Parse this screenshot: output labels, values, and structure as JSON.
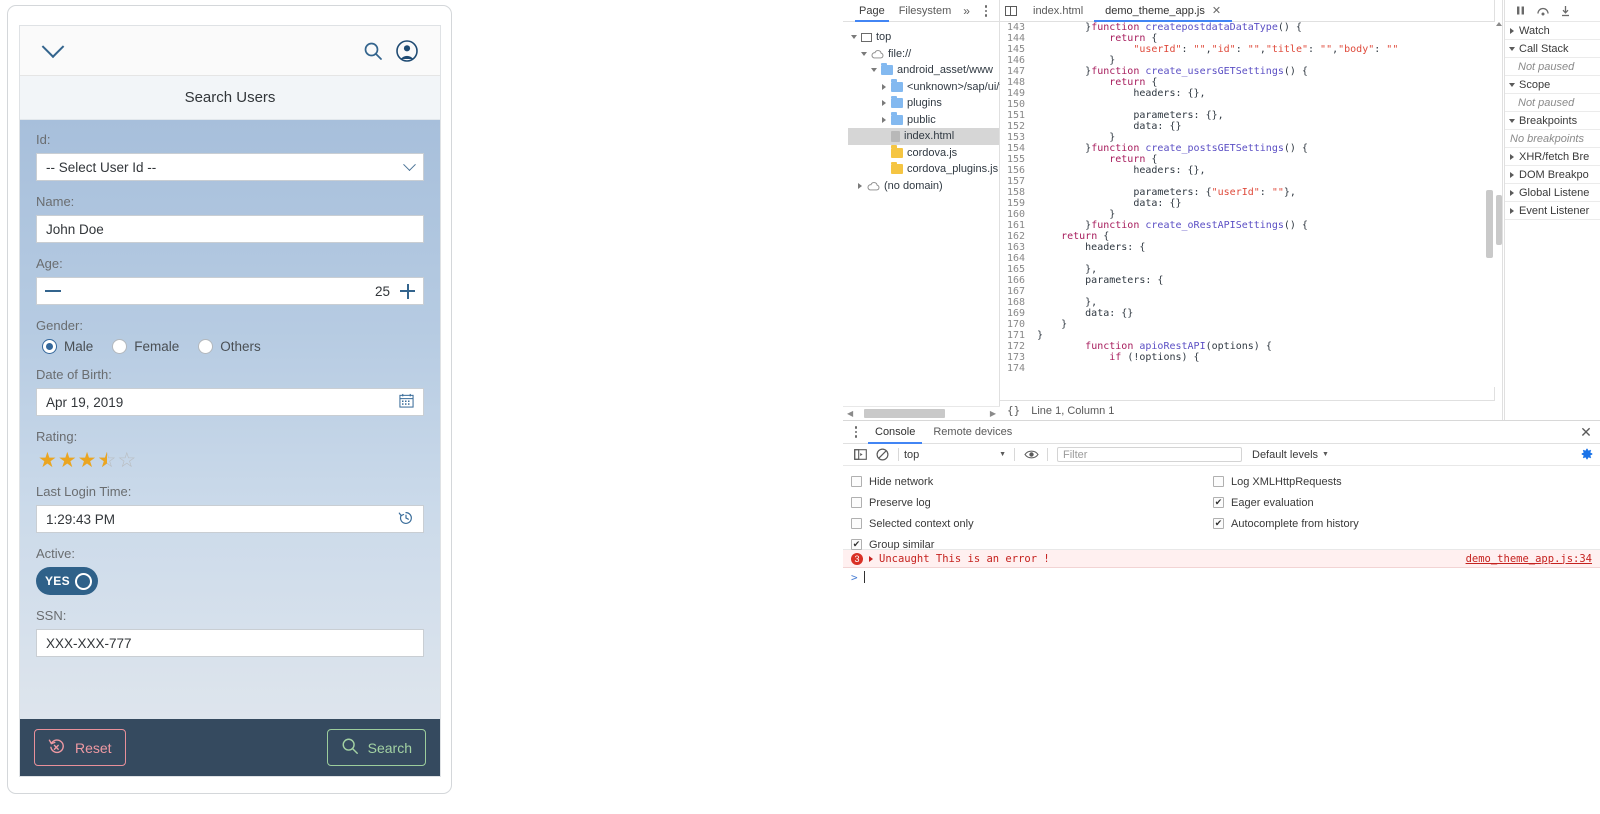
{
  "app": {
    "shellbar": {
      "menu_icon": "chevron-down-icon",
      "search_icon": "search-icon",
      "avatar_icon": "user-avatar-icon"
    },
    "page_title": "Search Users",
    "fields": {
      "id": {
        "label": "Id:",
        "value": "-- Select User Id --"
      },
      "name": {
        "label": "Name:",
        "value": "John Doe"
      },
      "age": {
        "label": "Age:",
        "value": "25",
        "minus_icon": "minus-icon",
        "plus_icon": "plus-icon"
      },
      "gender": {
        "label": "Gender:",
        "options": [
          {
            "label": "Male",
            "selected": true
          },
          {
            "label": "Female",
            "selected": false
          },
          {
            "label": "Others",
            "selected": false
          }
        ]
      },
      "dob": {
        "label": "Date of Birth:",
        "value": "Apr 19, 2019",
        "icon": "calendar-icon"
      },
      "rating": {
        "label": "Rating:",
        "value": 3.5,
        "max": 5,
        "color": "#eaa521"
      },
      "last_login": {
        "label": "Last Login Time:",
        "value": "1:29:43 PM",
        "icon": "clock-history-icon"
      },
      "active": {
        "label": "Active:",
        "toggle_text": "YES",
        "on": true
      },
      "ssn": {
        "label": "SSN:",
        "value": "XXX-XXX-777"
      }
    },
    "footer": {
      "reset_label": "Reset",
      "reset_icon": "reset-undo-icon",
      "search_label": "Search",
      "search_icon": "search-icon"
    },
    "colors": {
      "footer_bg": "#354a5f",
      "reset": "#ef9aa3",
      "search": "#a3d2a3",
      "toggle_on": "#2f6189"
    }
  },
  "devtools": {
    "nav": {
      "tabs": [
        {
          "label": "Page",
          "active": true
        },
        {
          "label": "Filesystem",
          "active": false
        },
        {
          "label": "»",
          "active": false
        }
      ],
      "more_icon": "kebab-menu-icon",
      "tree": [
        {
          "label": "top",
          "depth": 0,
          "icon": "frame-icon",
          "arrow": "open"
        },
        {
          "label": "file://",
          "depth": 1,
          "icon": "cloud-icon",
          "arrow": "open"
        },
        {
          "label": "android_asset/www",
          "depth": 2,
          "icon": "folder-icon",
          "arrow": "open"
        },
        {
          "label": "<unknown>/sap/ui/th",
          "depth": 3,
          "icon": "folder-icon",
          "arrow": "closed"
        },
        {
          "label": "plugins",
          "depth": 3,
          "icon": "folder-icon",
          "arrow": "closed"
        },
        {
          "label": "public",
          "depth": 3,
          "icon": "folder-icon",
          "arrow": "closed"
        },
        {
          "label": "index.html",
          "depth": 3,
          "icon": "file-icon",
          "arrow": "none",
          "selected": true
        },
        {
          "label": "cordova.js",
          "depth": 3,
          "icon": "js-file-icon",
          "arrow": "none"
        },
        {
          "label": "cordova_plugins.js",
          "depth": 3,
          "icon": "js-file-icon",
          "arrow": "none"
        },
        {
          "label": "(no domain)",
          "depth": 1,
          "icon": "cloud-icon",
          "arrow": "closed"
        }
      ]
    },
    "editor": {
      "toggle_icon": "panel-toggle-icon",
      "tabs": [
        {
          "label": "index.html",
          "active": false,
          "closable": false
        },
        {
          "label": "demo_theme_app.js",
          "active": true,
          "closable": true,
          "close_icon": "close-icon"
        }
      ],
      "first_line": 143,
      "lines": [
        "        }function createpostdataDataType() {",
        "            return {",
        "                \"userId\": \"\",\"id\": \"\",\"title\": \"\",\"body\": \"\"",
        "            }",
        "        }function create_usersGETSettings() {",
        "            return {",
        "                headers: {},",
        "",
        "                parameters: {},",
        "                data: {}",
        "            }",
        "        }function create_postsGETSettings() {",
        "            return {",
        "                headers: {},",
        "",
        "                parameters: {\"userId\": \"\"},",
        "                data: {}",
        "            }",
        "        }function create_oRestAPISettings() {",
        "    return {",
        "        headers: {",
        "",
        "        },",
        "        parameters: {",
        "",
        "        },",
        "        data: {}",
        "    }",
        "}",
        "        function apioRestAPI(options) {",
        "            if (!options) {",
        ""
      ],
      "status": {
        "format_icon": "{}",
        "position": "Line 1, Column 1"
      }
    },
    "debugger": {
      "controls": [
        {
          "name": "pause-script-icon"
        },
        {
          "name": "step-over-icon"
        },
        {
          "name": "step-into-icon"
        }
      ],
      "sections": [
        {
          "label": "Watch",
          "open": false
        },
        {
          "label": "Call Stack",
          "open": true,
          "body": "Not paused"
        },
        {
          "label": "Scope",
          "open": true,
          "body": "Not paused"
        },
        {
          "label": "Breakpoints",
          "open": true,
          "body": "No breakpoints"
        },
        {
          "label": "XHR/fetch Bre",
          "open": false
        },
        {
          "label": "DOM Breakpo",
          "open": false
        },
        {
          "label": "Global Listene",
          "open": false
        },
        {
          "label": "Event Listener",
          "open": false
        }
      ]
    },
    "console": {
      "more_icon": "kebab-menu-icon",
      "tabs": [
        {
          "label": "Console",
          "active": true
        },
        {
          "label": "Remote devices",
          "active": false
        }
      ],
      "close_icon": "close-icon",
      "toolbar": {
        "sidebar_icon": "console-sidebar-icon",
        "clear_icon": "clear-console-icon",
        "context": "top",
        "eye_icon": "live-expression-icon",
        "filter_placeholder": "Filter",
        "filter_value": "",
        "levels": "Default levels",
        "gear_icon": "settings-gear-icon"
      },
      "settings_left": [
        {
          "label": "Hide network",
          "checked": false
        },
        {
          "label": "Preserve log",
          "checked": false
        },
        {
          "label": "Selected context only",
          "checked": false
        },
        {
          "label": "Group similar",
          "checked": true
        }
      ],
      "settings_right": [
        {
          "label": "Log XMLHttpRequests",
          "checked": false
        },
        {
          "label": "Eager evaluation",
          "checked": true
        },
        {
          "label": "Autocomplete from history",
          "checked": true
        }
      ],
      "messages": [
        {
          "level": "error",
          "count": "3",
          "text": "Uncaught This is an error !",
          "source": "demo_theme_app.js:34"
        }
      ],
      "prompt_symbol": ">"
    }
  }
}
